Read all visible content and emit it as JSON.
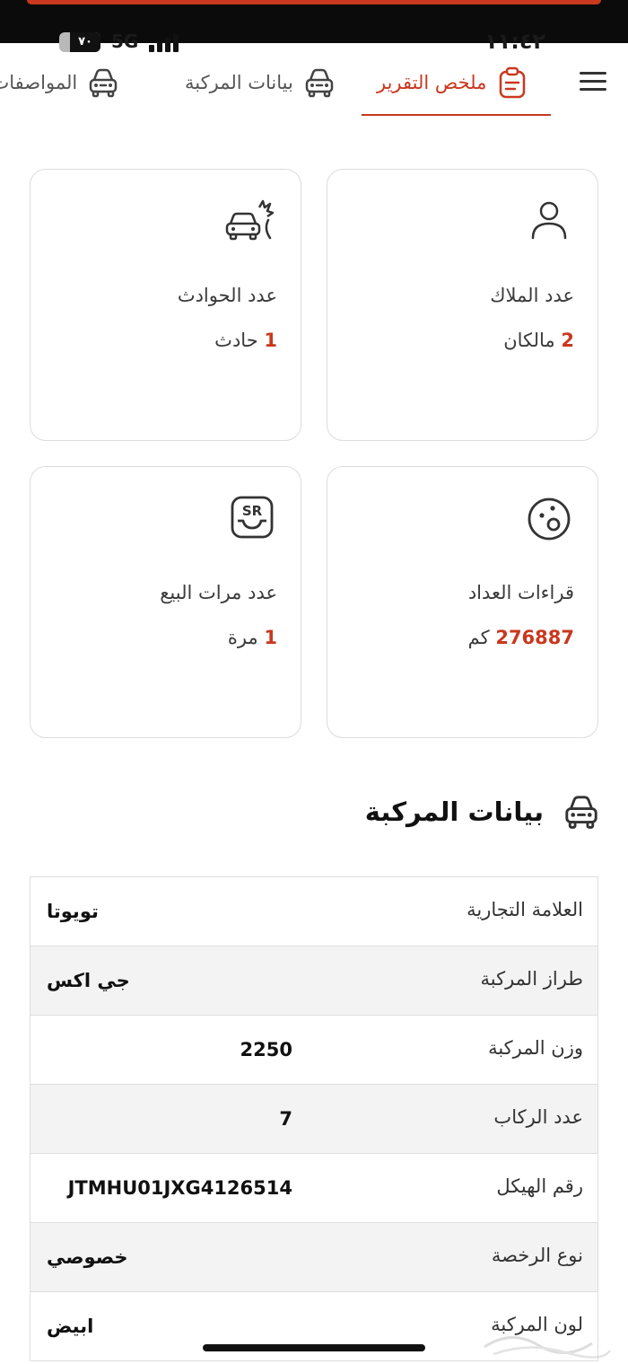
{
  "status_bar": {
    "time": "١١:٤٢",
    "battery": "٧٠",
    "network": "5G"
  },
  "tabs": [
    {
      "label": "ملخص التقرير",
      "icon": "clipboard-icon",
      "active": true
    },
    {
      "label": "بيانات المركبة",
      "icon": "car-icon",
      "active": false
    },
    {
      "label": "المواصفات ا",
      "icon": "car-icon",
      "active": false
    }
  ],
  "summary_cards": [
    {
      "label": "عدد الملاك",
      "number": "2",
      "unit": "مالكان",
      "icon": "user-icon"
    },
    {
      "label": "عدد الحوادث",
      "number": "1",
      "unit": "حادث",
      "icon": "car-crash-icon"
    },
    {
      "label": "قراءات العداد",
      "number": "276887",
      "unit": "كم",
      "icon": "odometer-icon"
    },
    {
      "label": "عدد مرات البيع",
      "number": "1",
      "unit": "مرة",
      "icon": "sr-sale-icon"
    }
  ],
  "vehicle_section": {
    "title": "بيانات المركبة",
    "icon": "car-icon",
    "rows": [
      {
        "label": "العلامة التجارية",
        "value": "تويوتا"
      },
      {
        "label": "طراز المركبة",
        "value": "جي اكس"
      },
      {
        "label": "وزن المركبة",
        "value": "2250"
      },
      {
        "label": "عدد الركاب",
        "value": "7"
      },
      {
        "label": "رقم الهيكل",
        "value": "JTMHU01JXG4126514"
      },
      {
        "label": "نوع الرخصة",
        "value": "خصوصي"
      },
      {
        "label": "لون المركبة",
        "value": "ابيض"
      }
    ]
  },
  "colors": {
    "accent": "#c9381f",
    "border": "#dcdcdc",
    "row_alt": "#f3f3f3"
  }
}
